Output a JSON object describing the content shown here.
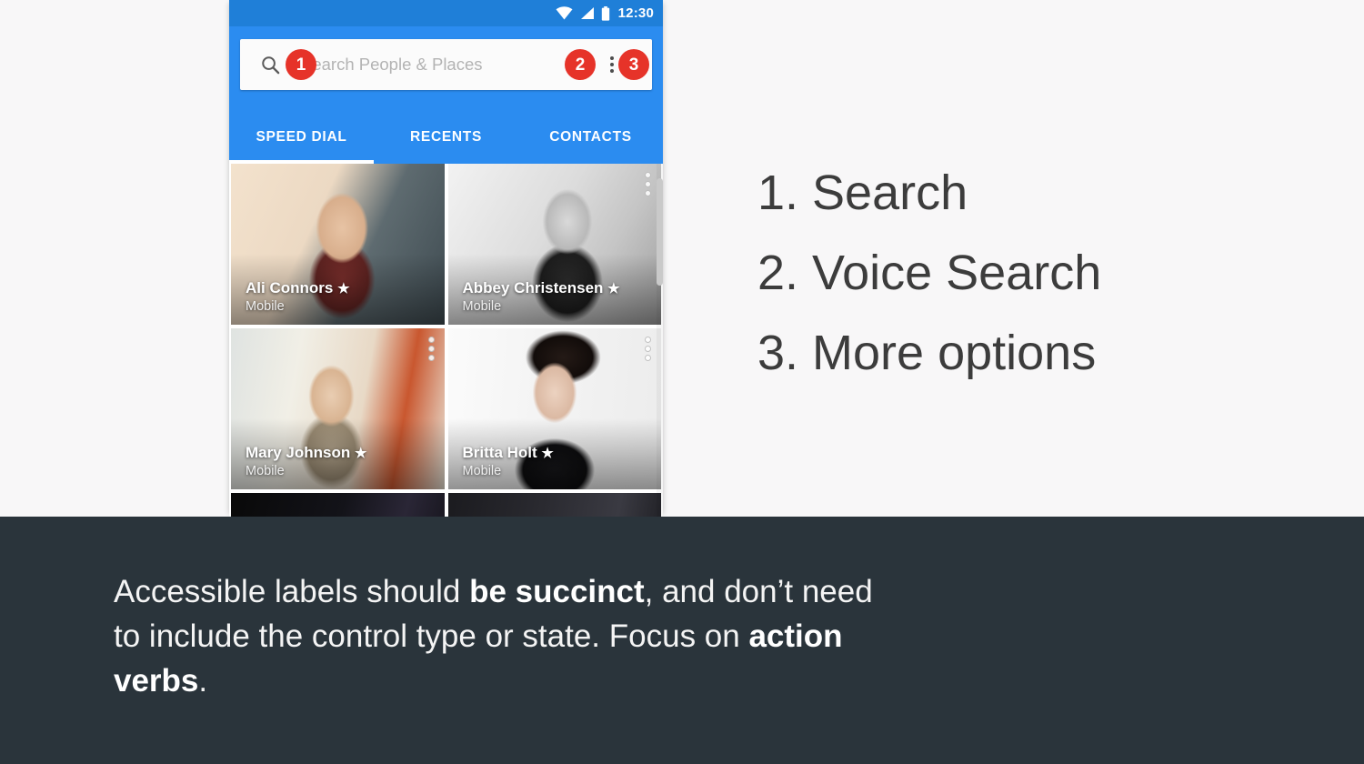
{
  "page": {
    "background_color": "#f8f7f8",
    "caption_band_color": "#2a343b",
    "accent_blue": "#2b8cf0",
    "statusbar_blue": "#1f7fd8",
    "badge_red": "#e63329",
    "legend_text_color": "#3c3c3c"
  },
  "phone": {
    "statusbar": {
      "clock": "12:30",
      "icons": [
        "wifi-icon",
        "cellular-signal-icon",
        "battery-icon"
      ]
    },
    "search": {
      "placeholder": "Search People  & Places",
      "value": "",
      "search_icon": "search-icon",
      "voice_icon": "microphone-icon",
      "overflow_icon": "more-vert-icon"
    },
    "callouts": [
      {
        "number": "1",
        "target": "search-icon"
      },
      {
        "number": "2",
        "target": "microphone-icon"
      },
      {
        "number": "3",
        "target": "more-vert-icon"
      }
    ],
    "tabs": [
      {
        "label": "SPEED DIAL",
        "active": true
      },
      {
        "label": "RECENTS",
        "active": false
      },
      {
        "label": "CONTACTS",
        "active": false
      }
    ],
    "contacts": [
      {
        "name": "Ali Connors",
        "star": "★",
        "subtitle": "Mobile",
        "photo_class": "ph-ali",
        "overflow": false
      },
      {
        "name": "Abbey Christensen",
        "star": "★",
        "subtitle": "Mobile",
        "photo_class": "ph-abbey",
        "overflow": true
      },
      {
        "name": "Mary Johnson",
        "star": "★",
        "subtitle": "Mobile",
        "photo_class": "ph-mary",
        "overflow": true
      },
      {
        "name": "Britta Holt",
        "star": "★",
        "subtitle": "Mobile",
        "photo_class": "ph-britta",
        "overflow": true
      },
      {
        "name": "",
        "star": "",
        "subtitle": "",
        "photo_class": "ph-dark1",
        "overflow": false
      },
      {
        "name": "",
        "star": "",
        "subtitle": "",
        "photo_class": "ph-dark2",
        "overflow": false
      }
    ]
  },
  "legend": {
    "items": [
      "1. Search",
      "2. Voice Search",
      "3. More options"
    ]
  },
  "caption": {
    "segments": [
      {
        "text": "Accessible labels should ",
        "bold": false
      },
      {
        "text": "be succinct",
        "bold": true
      },
      {
        "text": ", and don’t need to include the control type or state. Focus on ",
        "bold": false
      },
      {
        "text": "action verbs",
        "bold": true
      },
      {
        "text": ".",
        "bold": false
      }
    ]
  }
}
